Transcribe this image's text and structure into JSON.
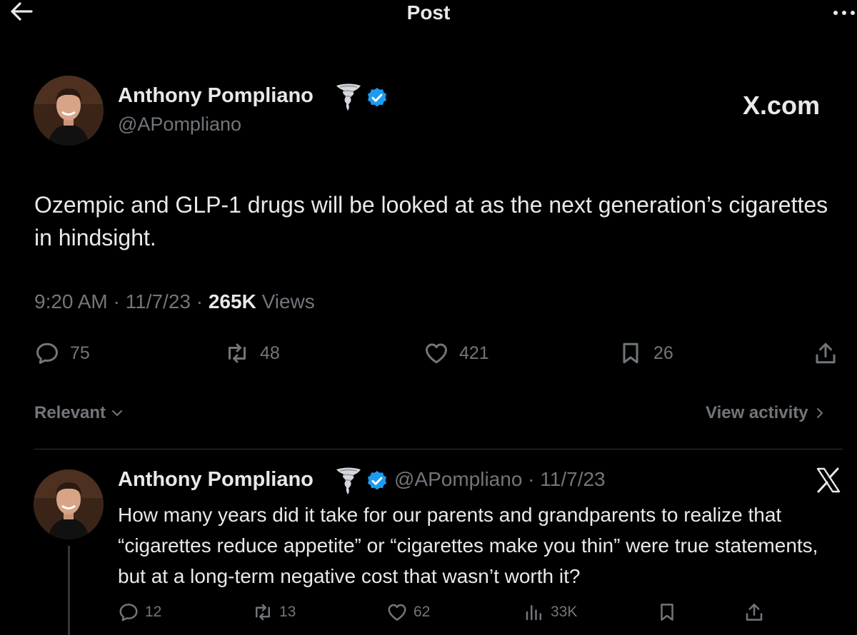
{
  "header": {
    "title": "Post"
  },
  "brand": {
    "watermark": "X.com"
  },
  "post": {
    "author_name": "Anthony Pompliano",
    "author_handle": "@APompliano",
    "text": "Ozempic and GLP-1 drugs will be looked at as the next generation’s cigarettes in hindsight.",
    "time": "9:20 AM",
    "date": "11/7/23",
    "views_count": "265K",
    "views_label": "Views",
    "sep": "·",
    "replies": "75",
    "reposts": "48",
    "likes": "421",
    "bookmarks": "26"
  },
  "sort": {
    "label": "Relevant",
    "view_activity": "View activity"
  },
  "reply": {
    "author_name": "Anthony Pompliano",
    "handle_date": "@APompliano · 11/7/23",
    "text": "How many years did it take for our parents and grandparents to realize that “cigarettes reduce appetite” or “cigarettes make you thin” were true statements, but at a long-term negative cost that wasn’t worth it?",
    "replies": "12",
    "reposts": "13",
    "likes": "62",
    "views": "33K"
  },
  "colors": {
    "background": "#000000",
    "text": "#e7e9ea",
    "muted": "#71767b",
    "verified": "#1d9bf0",
    "divider": "#2f3336"
  },
  "icons": [
    "back-arrow-icon",
    "more-icon",
    "tornado-badge-icon",
    "verified-badge-icon",
    "reply-icon",
    "repost-icon",
    "like-icon",
    "bookmark-icon",
    "share-icon",
    "views-icon",
    "x-logo-icon",
    "chevron-down-icon",
    "chevron-right-icon"
  ]
}
